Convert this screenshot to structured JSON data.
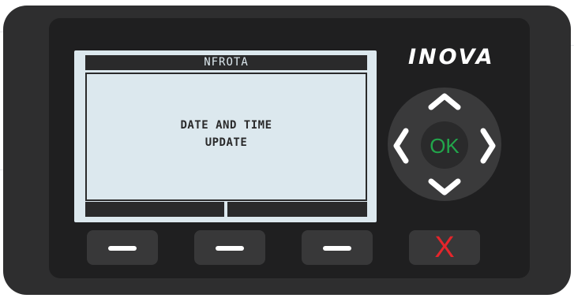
{
  "device": {
    "brand": "INOVA",
    "colors": {
      "body": "#2e2e2f",
      "bezel": "#1f1f20",
      "lcd_background": "#dce8ee",
      "lcd_ink": "#2a2a2b",
      "ok_text": "#22a64b",
      "cancel": "#e5252b"
    }
  },
  "lcd": {
    "title": "NFROTA",
    "message_line1": "DATE AND TIME",
    "message_line2": "UPDATE",
    "softkeys": [
      "",
      ""
    ]
  },
  "keypad": {
    "ok_label": "OK",
    "icons": {
      "up": "chevron-up-icon",
      "down": "chevron-down-icon",
      "left": "chevron-left-icon",
      "right": "chevron-right-icon"
    }
  },
  "buttons": {
    "function_icons": [
      "minus-icon",
      "minus-icon",
      "minus-icon"
    ],
    "cancel_label": "X"
  }
}
